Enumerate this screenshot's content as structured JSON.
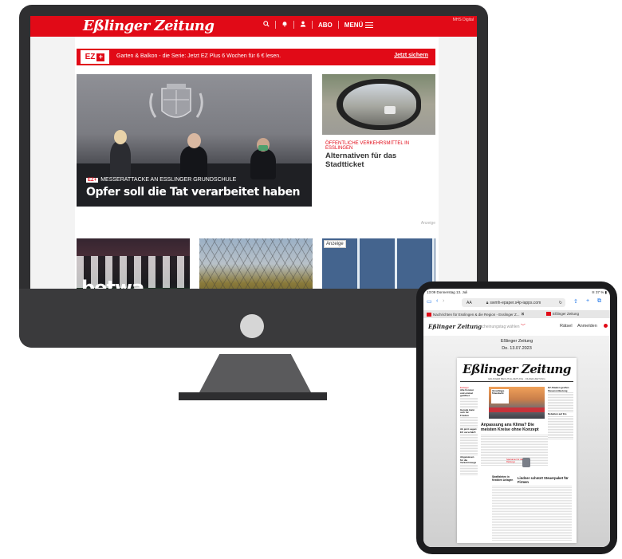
{
  "imac": {
    "site": {
      "logo": "Eßlinger Zeitung",
      "header": {
        "search_icon": "search-icon",
        "bell_icon": "bell-icon",
        "user_icon": "user-icon",
        "abo_label": "ABO",
        "menu_label": "MENÜ",
        "external": "MHS Digital"
      },
      "promo": {
        "badge": "EZ",
        "badge_plus": "+",
        "text": "Garten & Balkon - die Serie: Jetzt EZ Plus 6 Wochen für 6 € lesen.",
        "cta": "Jetzt sichern"
      },
      "hero": {
        "badge": "EZ",
        "badge_plus": "+",
        "kicker": "MESSERATTACKE AN ESSLINGER GRUNDSCHULE",
        "title": "Opfer soll die Tat verarbeitet haben"
      },
      "side_story": {
        "kicker": "ÖFFENTLICHE VERKEHRSMITTEL IN ESSLINGEN",
        "title": "Alternativen für das Stadtticket"
      },
      "tiles": {
        "anzeige_label": "Anzeige",
        "tile1_text": "betwa",
        "tile3_badge": "Anzeige"
      }
    }
  },
  "ipad": {
    "status": {
      "time": "13:09  Donnerstag 13. Juli",
      "battery": "37 %"
    },
    "browser": {
      "aa": "AA",
      "url": "swmh-epaper.s4p-iapps.com",
      "tab1": "Nachrichten für Esslingen & die Region - Esslinger Z...",
      "tab2": "Eßlinger Zeitung"
    },
    "epaper": {
      "logo": "Eßlinger Zeitung",
      "date_select": "Erscheinungstag wählen",
      "raetsel": "Rätsel",
      "login": "Anmelden",
      "publication": "Eßlinger Zeitung",
      "date": "Do. 13.07.2023",
      "newspaper": {
        "masthead": "Eßlinger Zeitung",
        "subtitle": "EßLINGER BECHTLE-ZEITUNG · FILDER-ZEITUNG",
        "photo_caption": "Vorsichtiges Tatverdacht",
        "left_kicker": "Esslingen",
        "left_h1": "Alle Fenster und einmal geöffnet",
        "left_h2": "Gerade kann sich für Frieden",
        "left_h3": "Ab jetzt sagen: EU verschärft",
        "left_h4": "Abgewiesen für die Verkehrswege",
        "right_h1": "EZ-Staaten greifen Steuerentlastung",
        "right_h2": "Debatten auf Eis",
        "headline": "Anpassung ans Klima? Die meisten Kreise ohne Konzept",
        "red_box": "Sparsamer für die Radwege",
        "h_small": "Straffahrten in flexiblen Anlagen",
        "headline2": "Lindner schnürt Steuerpaket für Firmen"
      }
    }
  }
}
